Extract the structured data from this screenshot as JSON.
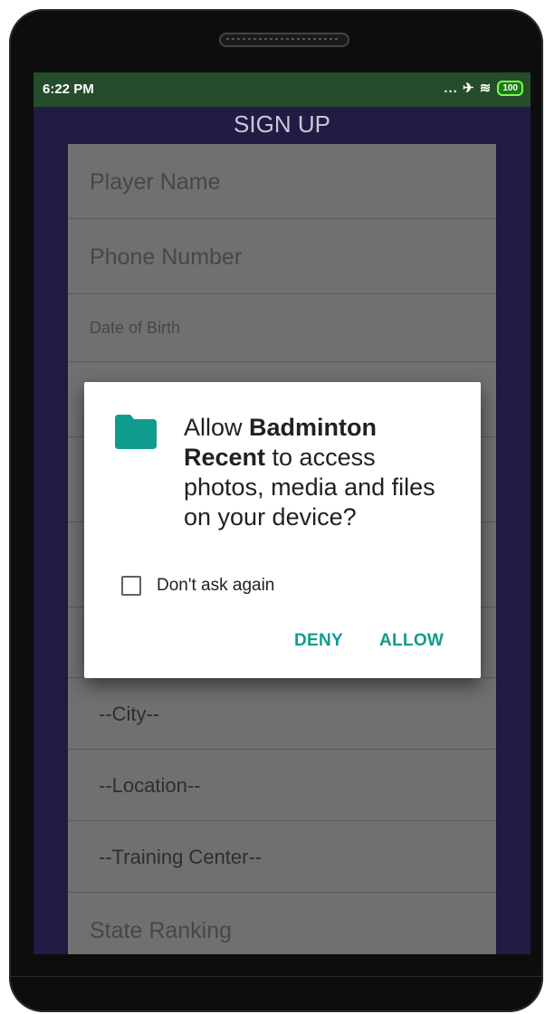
{
  "status_bar": {
    "time": "6:22 PM",
    "icons": "... ✈ ≋",
    "battery": "100"
  },
  "form": {
    "title": "SIGN UP",
    "player_name_placeholder": "Player Name",
    "phone_number_placeholder": "Phone Number",
    "dob_placeholder": "Date of Birth",
    "city": "--City--",
    "location": "--Location--",
    "training_center": "--Training Center--",
    "state_ranking_placeholder": "State Ranking"
  },
  "dialog": {
    "icon": "folder-icon",
    "message_prefix": "Allow ",
    "app_name": "Badminton Recent",
    "message_suffix": " to access photos, media and files on your device?",
    "checkbox_label": "Don't ask again",
    "checkbox_checked": false,
    "deny_label": "DENY",
    "allow_label": "ALLOW",
    "accent_color": "#0f9c8f"
  },
  "colors": {
    "screen_bg": "#231b43",
    "status_bar_bg": "#254d2b"
  }
}
